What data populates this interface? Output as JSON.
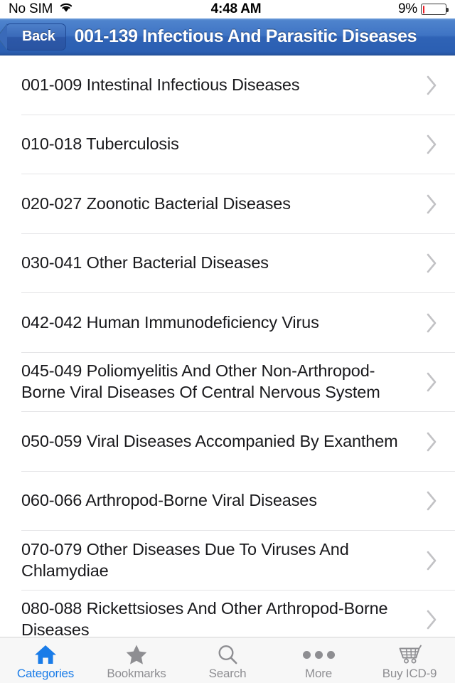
{
  "status_bar": {
    "carrier": "No SIM",
    "wifi_icon": "wifi-icon",
    "time": "4:48 AM",
    "battery_percent_label": "9%",
    "battery_level": 9,
    "battery_color": "#ee1c25"
  },
  "nav_bar": {
    "back_label": "Back",
    "title": "001-139 Infectious And Parasitic Diseases",
    "background_color": "#3f74c4",
    "title_color": "#ffffff"
  },
  "list": {
    "rows": [
      {
        "label": "001-009 Intestinal Infectious Diseases",
        "accessory": "chevron-right-icon"
      },
      {
        "label": "010-018 Tuberculosis",
        "accessory": "chevron-right-icon"
      },
      {
        "label": "020-027 Zoonotic Bacterial Diseases",
        "accessory": "chevron-right-icon"
      },
      {
        "label": "030-041 Other Bacterial Diseases",
        "accessory": "chevron-right-icon"
      },
      {
        "label": "042-042 Human Immunodeficiency Virus",
        "accessory": "chevron-right-icon"
      },
      {
        "label": "045-049 Poliomyelitis And Other Non-Arthropod-Borne Viral Diseases Of Central Nervous System",
        "accessory": "chevron-right-icon"
      },
      {
        "label": "050-059 Viral Diseases Accompanied By Exanthem",
        "accessory": "chevron-right-icon"
      },
      {
        "label": "060-066 Arthropod-Borne Viral Diseases",
        "accessory": "chevron-right-icon"
      },
      {
        "label": "070-079 Other Diseases Due To Viruses And Chlamydiae",
        "accessory": "chevron-right-icon"
      },
      {
        "label": "080-088 Rickettsioses And Other Arthropod-Borne Diseases",
        "accessory": "chevron-right-icon"
      }
    ]
  },
  "tab_bar": {
    "active_color": "#1a7ce8",
    "inactive_color": "#8e8e92",
    "tabs": [
      {
        "label": "Categories",
        "icon": "home-icon",
        "active": true
      },
      {
        "label": "Bookmarks",
        "icon": "star-icon",
        "active": false
      },
      {
        "label": "Search",
        "icon": "search-icon",
        "active": false
      },
      {
        "label": "More",
        "icon": "ellipsis-icon",
        "active": false
      },
      {
        "label": "Buy ICD-9",
        "icon": "cart-icon",
        "active": false
      }
    ]
  }
}
